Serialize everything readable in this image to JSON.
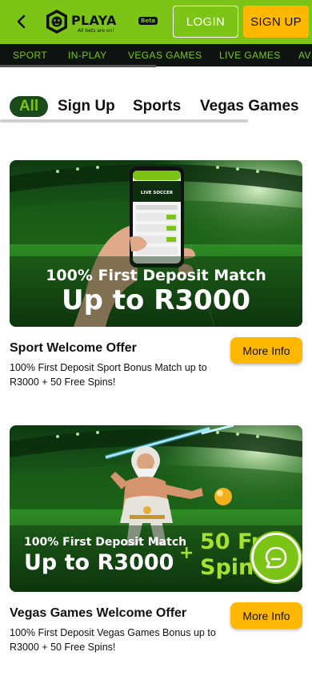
{
  "header": {
    "logo_text": "PLAYA",
    "logo_badge": "Beta",
    "logo_tagline": "All bets are on!",
    "login_label": "LOGIN",
    "signup_label": "SIGN UP"
  },
  "nav": {
    "items": [
      "SPORT",
      "IN-PLAY",
      "VEGAS GAMES",
      "LIVE GAMES",
      "AVI"
    ]
  },
  "tabs": {
    "items": [
      "All",
      "Sign Up",
      "Sports",
      "Vegas Games"
    ],
    "active": "All"
  },
  "promos": [
    {
      "banner_line1": "100% First Deposit Match",
      "banner_line2": "Up to R3000",
      "phone_text": "LIVE SOCCER",
      "title": "Sport Welcome Offer",
      "description": "100% First Deposit Sport Bonus Match up to R3000 + 50 Free Spins!",
      "button": "More Info"
    },
    {
      "banner_line1": "100% First Deposit Match",
      "banner_line2": "Up to R3000",
      "banner_plus": "+",
      "banner_side1": "50 Free",
      "banner_side2": "Spins",
      "title": "Vegas Games Welcome Offer",
      "description": "100% First Deposit Vegas Games Bonus up to R3000 + 50 Free Spins!",
      "button": "More Info"
    }
  ],
  "colors": {
    "brand_green": "#7cc516",
    "dark_green": "#1b4a1a",
    "accent_yellow": "#ffb700",
    "nav_bg": "#0f1412"
  },
  "icons": {
    "back": "chevron-left-icon",
    "logo": "lion-logo-icon",
    "chat": "chat-bubble-icon"
  }
}
